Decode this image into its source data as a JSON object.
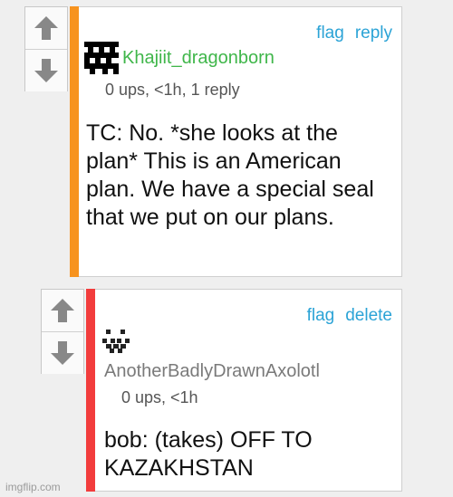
{
  "comments": [
    {
      "flag_label": "flag",
      "action_label": "reply",
      "username": "Khajiit_dragonborn",
      "username_color": "#3fb64a",
      "stripe_color": "#f7931e",
      "meta": "0 ups, <1h, 1 reply",
      "text": "TC: No. *she looks at the plan* This is an American plan. We have a special seal that we put on our plans.",
      "avatar_icon": "pixel-avatar-icon"
    },
    {
      "flag_label": "flag",
      "action_label": "delete",
      "username": "AnotherBadlyDrawnAxolotl",
      "username_color": "#7a7a7a",
      "stripe_color": "#f23c3c",
      "meta": "0 ups, <1h",
      "text": "bob: (takes) OFF TO KAZAKHSTAN",
      "avatar_icon": "pixel-avatar-icon"
    }
  ],
  "icons": {
    "upvote": "arrow-up-icon",
    "downvote": "arrow-down-icon"
  },
  "watermark": "imgflip.com"
}
